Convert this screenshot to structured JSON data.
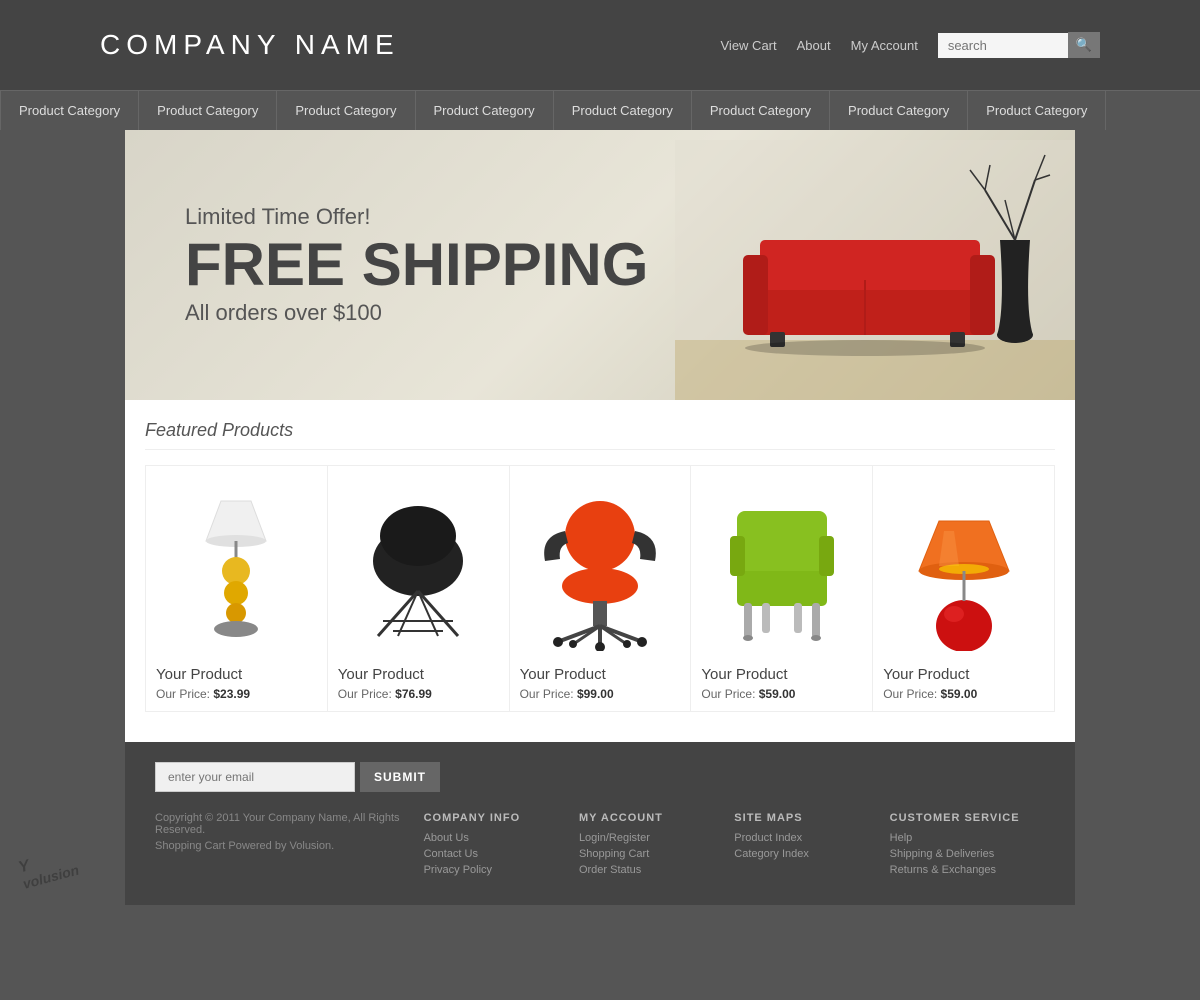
{
  "header": {
    "company_name": "COMPANY NAME",
    "links": [
      "View Cart",
      "About",
      "My Account"
    ],
    "search_placeholder": "search"
  },
  "nav": {
    "items": [
      "Product Category",
      "Product Category",
      "Product Category",
      "Product Category",
      "Product Category",
      "Product Category",
      "Product Category",
      "Product Category"
    ]
  },
  "banner": {
    "subtitle": "Limited Time Offer!",
    "title": "FREE SHIPPING",
    "description": "All orders over $100"
  },
  "featured": {
    "title": "Featured Products",
    "products": [
      {
        "name": "Your Product",
        "price_label": "Our Price:",
        "price": "$23.99"
      },
      {
        "name": "Your Product",
        "price_label": "Our Price:",
        "price": "$76.99"
      },
      {
        "name": "Your Product",
        "price_label": "Our Price:",
        "price": "$99.00"
      },
      {
        "name": "Your Product",
        "price_label": "Our Price:",
        "price": "$59.00"
      },
      {
        "name": "Your Product",
        "price_label": "Our Price:",
        "price": "$59.00"
      }
    ]
  },
  "footer": {
    "email_placeholder": "enter your email",
    "submit_label": "SUBMIT",
    "columns": [
      {
        "title": "COMPANY INFO",
        "links": [
          "About Us",
          "Contact Us",
          "Privacy Policy"
        ]
      },
      {
        "title": "MY ACCOUNT",
        "links": [
          "Login/Register",
          "Shopping Cart",
          "Order Status"
        ]
      },
      {
        "title": "SITE MAPS",
        "links": [
          "Product Index",
          "Category Index"
        ]
      },
      {
        "title": "CUSTOMER SERVICE",
        "links": [
          "Help",
          "Shipping & Deliveries",
          "Returns & Exchanges"
        ]
      }
    ],
    "copyright": "Copyright © 2011 Your Company Name, All Rights Reserved.",
    "powered": "Shopping Cart Powered by Volusion."
  },
  "watermark": "Yvolusion"
}
